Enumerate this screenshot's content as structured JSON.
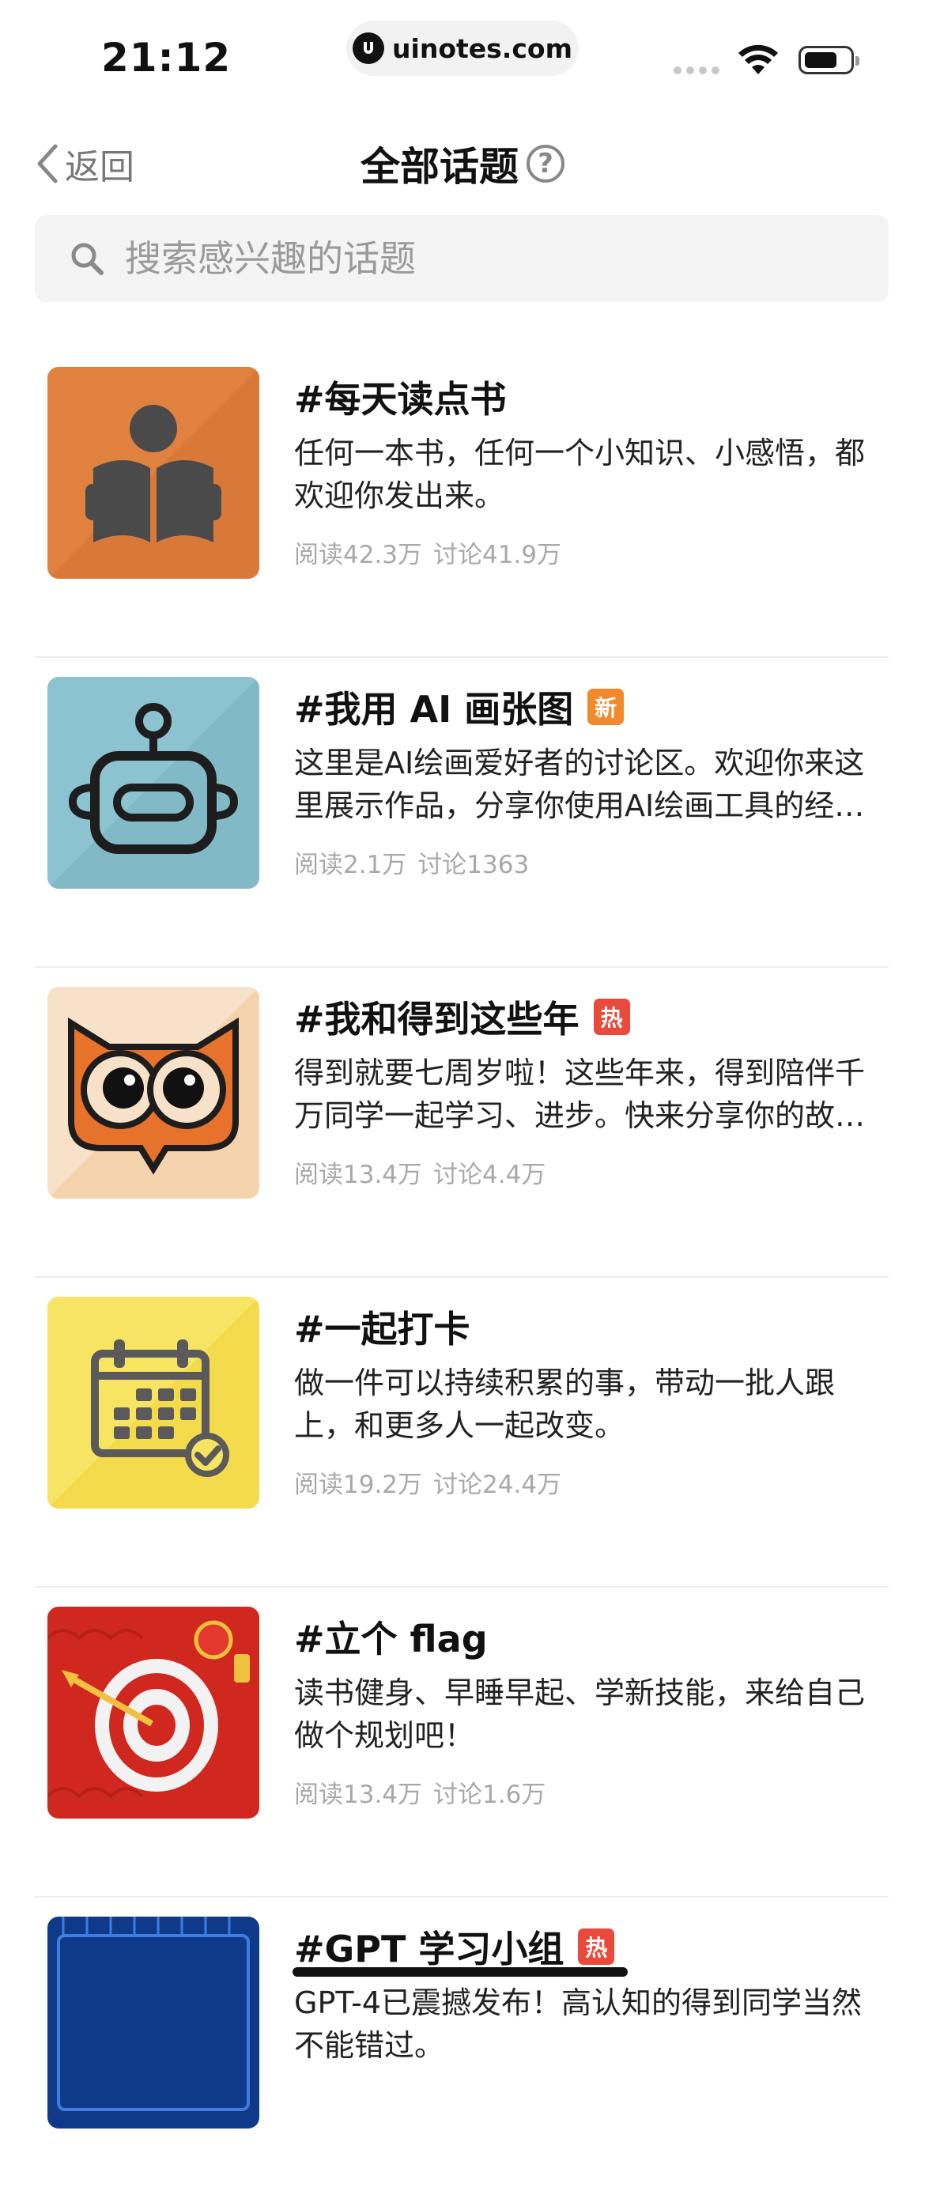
{
  "status_bar": {
    "time": "21:12",
    "url": "uinotes.com"
  },
  "nav": {
    "back_label": "返回",
    "title": "全部话题"
  },
  "search": {
    "placeholder": "搜索感兴趣的话题"
  },
  "colors": {
    "badge_new": "#f08a2c",
    "badge_hot": "#e84b3c"
  },
  "topics": [
    {
      "name": "#每天读点书",
      "badge": "",
      "desc": "任何一本书，任何一个小知识、小感悟，都欢迎你发出来。",
      "reads": "阅读42.3万",
      "discussions": "讨论41.9万",
      "icon": "book-reader-icon"
    },
    {
      "name": "#我用 AI 画张图",
      "badge": "新",
      "badge_type": "new",
      "desc": "这里是AI绘画爱好者的讨论区。欢迎你来这里展示作品，分享你使用AI绘画工具的经验。",
      "reads": "阅读2.1万",
      "discussions": "讨论1363",
      "icon": "robot-icon"
    },
    {
      "name": "#我和得到这些年",
      "badge": "热",
      "badge_type": "hot",
      "desc": "得到就要七周岁啦！这些年来，得到陪伴千万同学一起学习、进步。快来分享你的故事吧。",
      "reads": "阅读13.4万",
      "discussions": "讨论4.4万",
      "icon": "owl-icon"
    },
    {
      "name": "#一起打卡",
      "badge": "",
      "desc": "做一件可以持续积累的事，带动一批人跟上，和更多人一起改变。",
      "reads": "阅读19.2万",
      "discussions": "讨论24.4万",
      "icon": "calendar-check-icon"
    },
    {
      "name": "#立个 flag",
      "badge": "",
      "desc": "读书健身、早睡早起、学新技能，来给自己做个规划吧！",
      "reads": "阅读13.4万",
      "discussions": "讨论1.6万",
      "icon": "target-icon"
    },
    {
      "name": "#GPT 学习小组",
      "badge": "热",
      "badge_type": "hot",
      "desc": "GPT-4已震撼发布！高认知的得到同学当然不能错过。",
      "reads": "",
      "discussions": "",
      "icon": "gpt-chip-icon"
    }
  ]
}
